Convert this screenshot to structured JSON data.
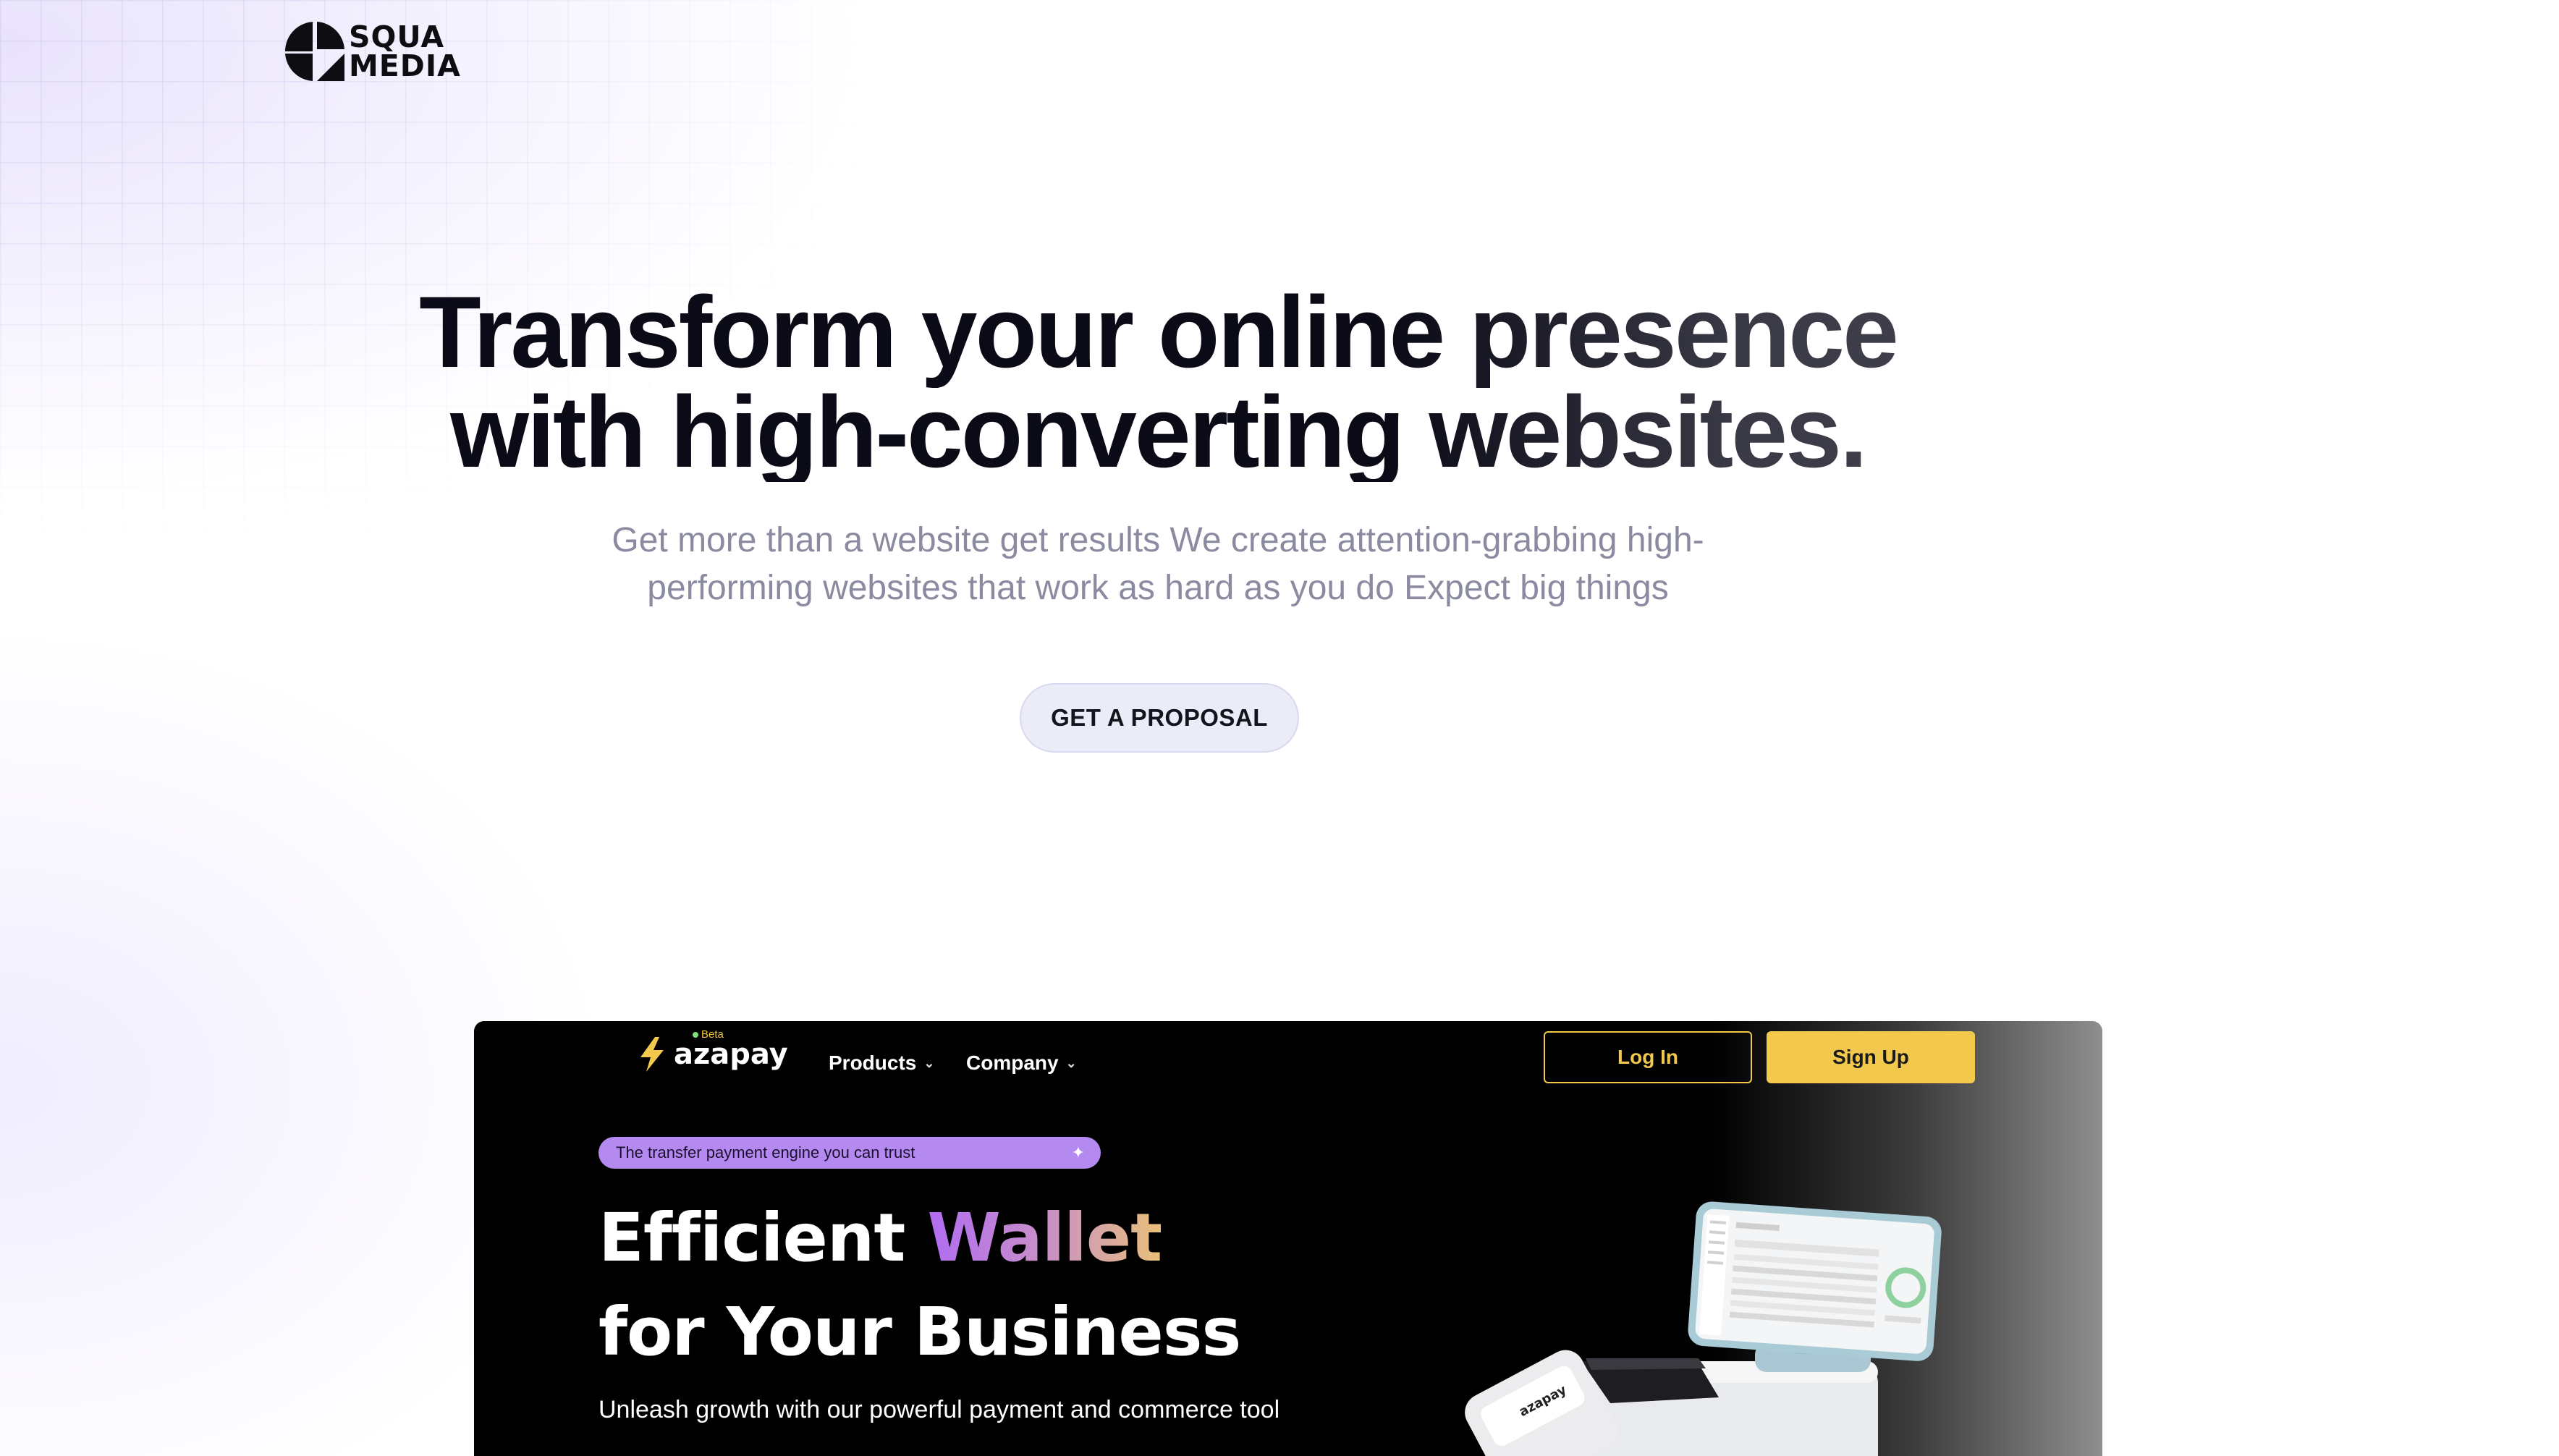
{
  "brand": {
    "logo_line1": "SQUA",
    "logo_line2": "MEDIA"
  },
  "hero": {
    "title_line1": "Transform your online presence",
    "title_line2": "with high-converting websites.",
    "subtitle_line1": "Get more than a website get results We create attention-grabbing high-",
    "subtitle_line2": "performing websites that work as hard as you do Expect big things",
    "cta_label": "GET A PROPOSAL"
  },
  "preview": {
    "brand_name": "azapay",
    "beta_label": "Beta",
    "nav": [
      {
        "label": "Products"
      },
      {
        "label": "Company"
      }
    ],
    "login_label": "Log In",
    "signup_label": "Sign Up",
    "tagline": "The transfer payment engine you can trust",
    "headline_word1": "Efficient",
    "headline_word2": "Wallet",
    "headline_line2": "for Your Business",
    "subheadline": "Unleash growth with our powerful payment and commerce tool",
    "device_label": "azapay"
  },
  "colors": {
    "accent_yellow": "#f2c94c",
    "pill_purple": "#b58af0",
    "cta_bg": "#ececf9",
    "title_dark": "#0b0b18",
    "subtitle_gray": "#8a8aa0"
  },
  "icons": [
    "squa-media-logo-icon",
    "azapay-bolt-icon",
    "chevron-down-icon",
    "sparkle-icon"
  ]
}
